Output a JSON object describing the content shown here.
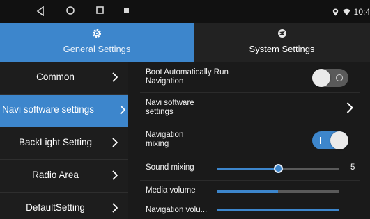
{
  "status_bar": {
    "nav_buttons": [
      "back-icon",
      "home-icon",
      "recent-apps-icon",
      "notification-icon"
    ],
    "icons": [
      "location-icon",
      "wifi-icon"
    ],
    "time": "10:4"
  },
  "tabs": [
    {
      "label": "General Settings",
      "icon": "gear-icon",
      "active": true
    },
    {
      "label": "System Settings",
      "icon": "system-icon",
      "active": false
    }
  ],
  "sidebar": {
    "items": [
      {
        "label": "Common",
        "active": false
      },
      {
        "label": "Navi software settings",
        "active": true
      },
      {
        "label": "BackLight Setting",
        "active": false
      },
      {
        "label": "Radio Area",
        "active": false
      },
      {
        "label": "DefaultSetting",
        "active": false
      }
    ]
  },
  "main": {
    "boot_run_nav": {
      "label": "Boot Automatically Run Navigation",
      "line1": "Boot Automatically Run",
      "line2": "Navigation",
      "on": false
    },
    "navi_software": {
      "line1": "Navi software",
      "line2": "settings"
    },
    "nav_mixing": {
      "line1": "Navigation",
      "line2": "mixing",
      "on": true
    },
    "sound_mixing": {
      "label": "Sound mixing",
      "value": "5",
      "fraction": 0.5
    },
    "media_volume": {
      "label": "Media volume",
      "fraction": 0.5
    },
    "navigation_volume": {
      "label": "Navigation volu...",
      "fraction": 1.0
    }
  },
  "colors": {
    "accent": "#3d86cc",
    "background": "#1a1a1a",
    "track": "#5a5a5a"
  }
}
